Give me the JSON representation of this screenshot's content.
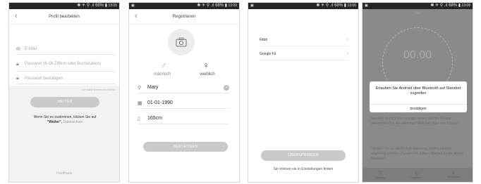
{
  "status_bar": {
    "icons": "✱ ✈ ⚲ .ıl 68% ▮",
    "times": [
      "13:05",
      "13:09",
      "13:06",
      "13:08"
    ]
  },
  "screen1": {
    "title": "Profil bearbeiten",
    "email_placeholder": "E-Mail",
    "password_placeholder": "Passwort (6-16 Ziffern oder Buchstaben)",
    "confirm_placeholder": "Passwort bestätigen",
    "have_account": "Ich habe bereits ein Konto",
    "next_button": "WEITER",
    "consent_text": "Wenn Sie es zustimmen, klicken Sie auf",
    "consent_word": "\"Weiter\",",
    "privacy_link": "Datenschutz",
    "feedback": "Feedback"
  },
  "screen2": {
    "title": "Registrieren",
    "gender_male": "männlich",
    "gender_female": "weiblich",
    "name": "Mary",
    "birthday": "01-01-1990",
    "height": "165cm",
    "confirm_button": "BESTÄTIGEN"
  },
  "screen3": {
    "items": [
      {
        "label": "Fitbit"
      },
      {
        "label": "Google Fit"
      }
    ],
    "skip_button": "ÜBERSPRINGEN",
    "settings_hint": "Sie können sie in Einstellungen finden"
  },
  "screen4": {
    "header": "Hea",
    "time": "00.00",
    "dialog_message": "Erlauben Sie Android über Bluetooth auf Standort zugreifen",
    "dialog_button": "bestätigen",
    "text1": "Genießt es nicht das einzige, sehen auf der Waage bekommen Sie die ultimative Wahrheit über den Körper!",
    "text2": "Denken Sie an die Bettluft-Messung. Sicher können angezeigt werden. Passen am frühen Morgen für die ideale Messzeit!",
    "tabs": [
      {
        "label": "Messung"
      },
      {
        "label": "Diagramm"
      },
      {
        "label": "Mein Konto"
      }
    ]
  },
  "colors": {
    "button_gray": "#c9c9c9",
    "status_bar": "#262626",
    "overlay": "#8a8a8a"
  }
}
